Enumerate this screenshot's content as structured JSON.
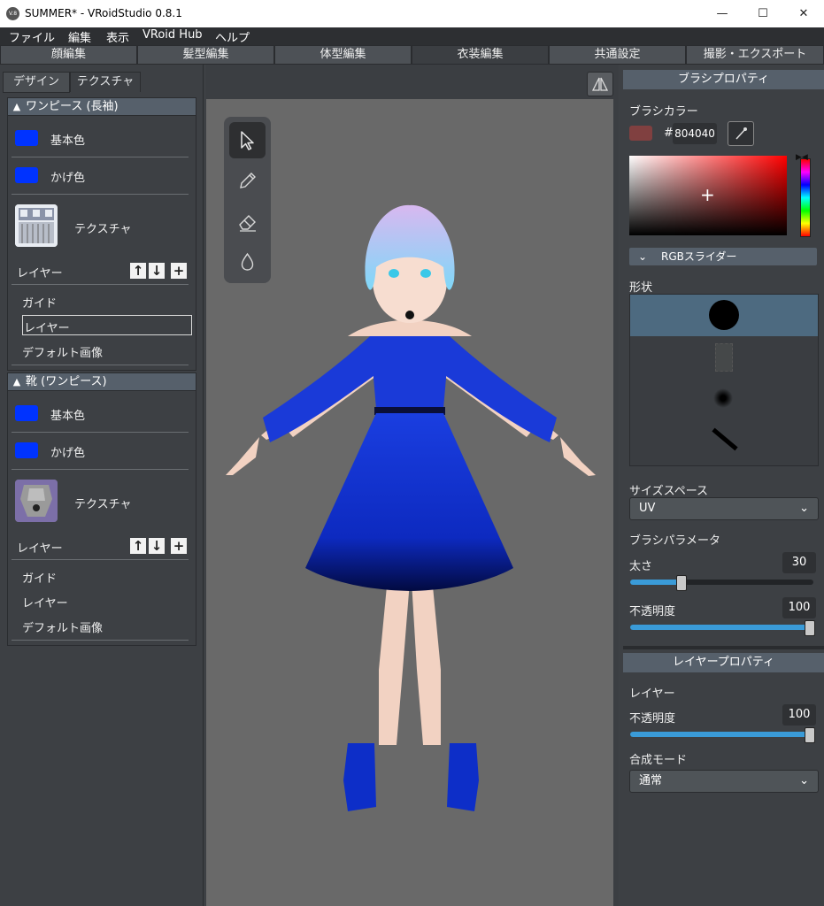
{
  "window": {
    "title": "SUMMER* - VRoidStudio 0.8.1",
    "icon_text": "V.8",
    "minimize": "—",
    "maximize": "☐",
    "close": "✕"
  },
  "menu": [
    "ファイル",
    "編集",
    "表示",
    "VRoid Hub",
    "ヘルプ"
  ],
  "main_tabs": [
    "顔編集",
    "髪型編集",
    "体型編集",
    "衣装編集",
    "共通設定",
    "撮影・エクスポート"
  ],
  "main_tab_active": "衣装編集",
  "left": {
    "subtabs": [
      "デザイン",
      "テクスチャ"
    ],
    "sections": [
      {
        "title": "ワンピース (長袖)",
        "base_color": "基本色",
        "shade_color": "かげ色",
        "texture": "テクスチャ",
        "layer": "レイヤー",
        "items": [
          "ガイド",
          "レイヤー",
          "デフォルト画像"
        ],
        "selected": "レイヤー"
      },
      {
        "title": "靴 (ワンピース)",
        "base_color": "基本色",
        "shade_color": "かげ色",
        "texture": "テクスチャ",
        "layer": "レイヤー",
        "items": [
          "ガイド",
          "レイヤー",
          "デフォルト画像"
        ]
      }
    ],
    "swatch_color": "#0033ff"
  },
  "brush": {
    "header": "ブラシプロパティ",
    "color_label": "ブラシカラー",
    "hash": "#",
    "hex": "804040",
    "color": "#804040",
    "rgb_slider": "RGBスライダー",
    "shape_label": "形状",
    "size_space_label": "サイズスペース",
    "size_space_value": "UV",
    "params_label": "ブラシパラメータ",
    "thickness_label": "太さ",
    "thickness_value": "30",
    "thickness_fraction": 0.3,
    "opacity_label": "不透明度",
    "opacity_value": "100",
    "opacity_fraction": 1.0
  },
  "layer_props": {
    "header": "レイヤープロパティ",
    "layer_label": "レイヤー",
    "opacity_label": "不透明度",
    "opacity_value": "100",
    "opacity_fraction": 1.0,
    "blend_label": "合成モード",
    "blend_value": "通常"
  },
  "accent": "#3a9bd8"
}
